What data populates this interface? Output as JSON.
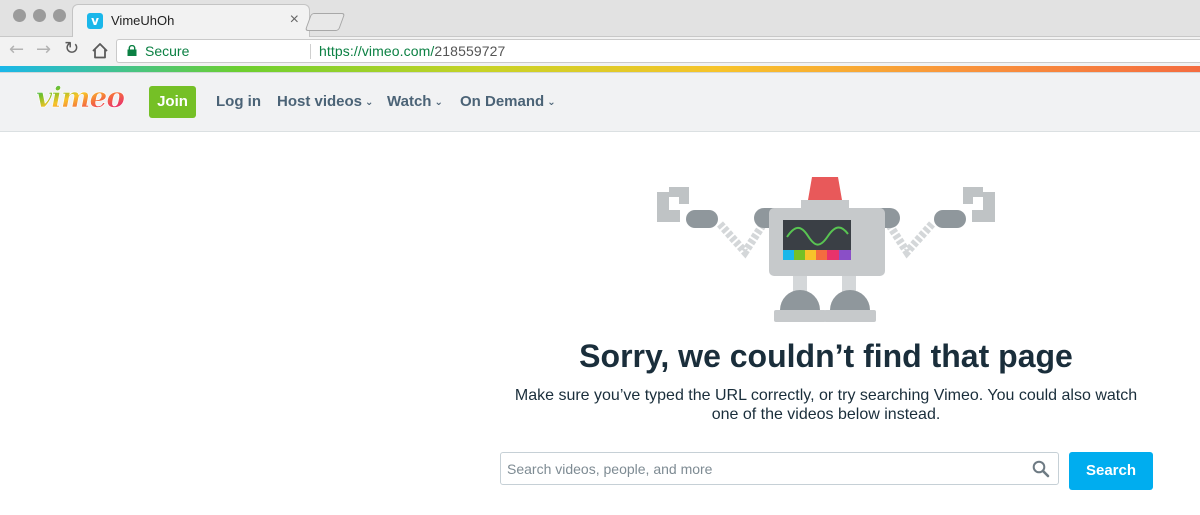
{
  "browser": {
    "tab_title": "VimeUhOh",
    "tab_close": "×",
    "security_label": "Secure",
    "url_scheme_host": "https://vimeo.com/",
    "url_path": "218559727"
  },
  "header": {
    "logo_text": "vimeo",
    "join_label": "Join",
    "nav": [
      {
        "label": "Log in"
      },
      {
        "label": "Host videos",
        "has_dropdown": true
      },
      {
        "label": "Watch",
        "has_dropdown": true
      },
      {
        "label": "On Demand",
        "has_dropdown": true
      }
    ]
  },
  "main": {
    "heading": "Sorry, we couldn’t find that page",
    "description": "Make sure you’ve typed the URL correctly, or try searching Vimeo. You could also watch one of the videos below instead.",
    "search_placeholder": "Search videos, people, and more",
    "search_button": "Search"
  },
  "colors": {
    "join_green": "#75c026",
    "search_blue": "#00adef",
    "nav_text": "#4b6376",
    "heading_text": "#1a2e3b",
    "secure_green": "#0b8043"
  },
  "icons": [
    "vimeo-favicon-icon",
    "close-icon",
    "back-icon",
    "forward-icon",
    "reload-icon",
    "home-icon",
    "lock-icon",
    "chevron-down-icon",
    "search-icon",
    "robot-illustration"
  ]
}
